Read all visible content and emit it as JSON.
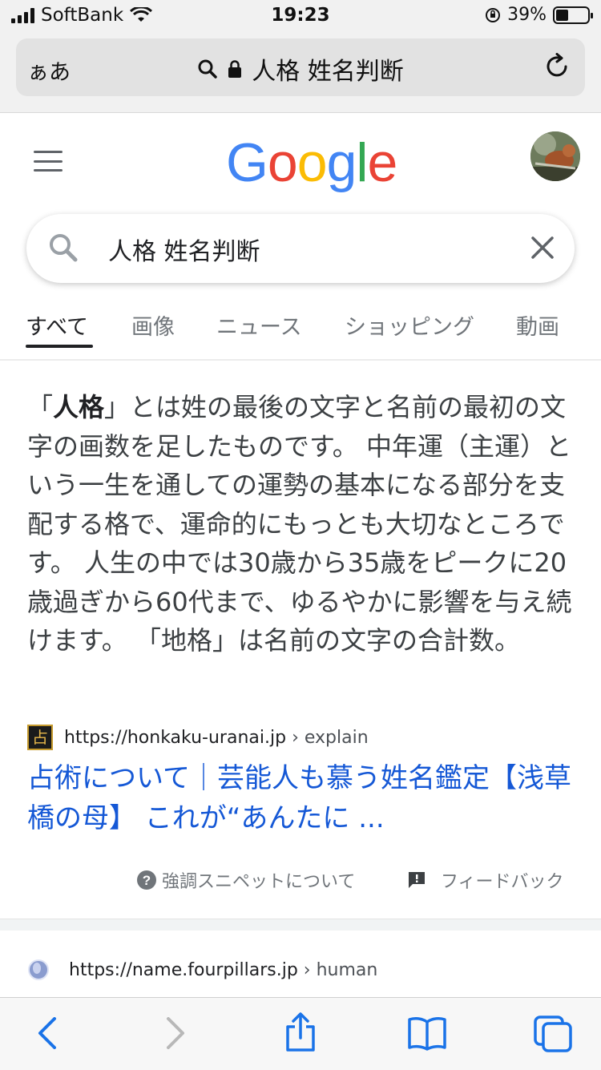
{
  "status_bar": {
    "carrier": "SoftBank",
    "time": "19:23",
    "battery": "39%",
    "battery_level": 0.39
  },
  "browser": {
    "text_size_label": "ぁあ",
    "url_text": "人格 姓名判断"
  },
  "google": {
    "logo_letters": [
      {
        "ch": "G",
        "color": "#4285F4"
      },
      {
        "ch": "o",
        "color": "#EA4335"
      },
      {
        "ch": "o",
        "color": "#FBBC05"
      },
      {
        "ch": "g",
        "color": "#4285F4"
      },
      {
        "ch": "l",
        "color": "#34A853"
      },
      {
        "ch": "e",
        "color": "#EA4335"
      }
    ],
    "query": "人格 姓名判断",
    "tabs": [
      "すべて",
      "画像",
      "ニュース",
      "ショッピング",
      "動画"
    ]
  },
  "snippet": {
    "quote_open": "「",
    "keyword": "人格",
    "text_rest": "」とは姓の最後の文字と名前の最初の文字の画数を足したものです。 中年運（主運）という一生を通しての運勢の基本になる部分を支配する格で、運命的にもっとも大切なところです。 人生の中では30歳から35歳をピークに20歳過ぎから60代まで、ゆるやかに影響を与え続けます。 「地格」は名前の文字の合計数。"
  },
  "result": {
    "favicon_char": "占",
    "url": "https://honkaku-uranai.jp",
    "breadcrumb": "› explain",
    "title": "占術について｜芸能人も慕う姓名鑑定【浅草橋の母】 これが“あんたに ..."
  },
  "feedback_row": {
    "about_label": "強調スニペットについて",
    "feedback_label": "フィードバック"
  },
  "result2": {
    "url": "https://name.fourpillars.jp",
    "breadcrumb": "› human"
  }
}
